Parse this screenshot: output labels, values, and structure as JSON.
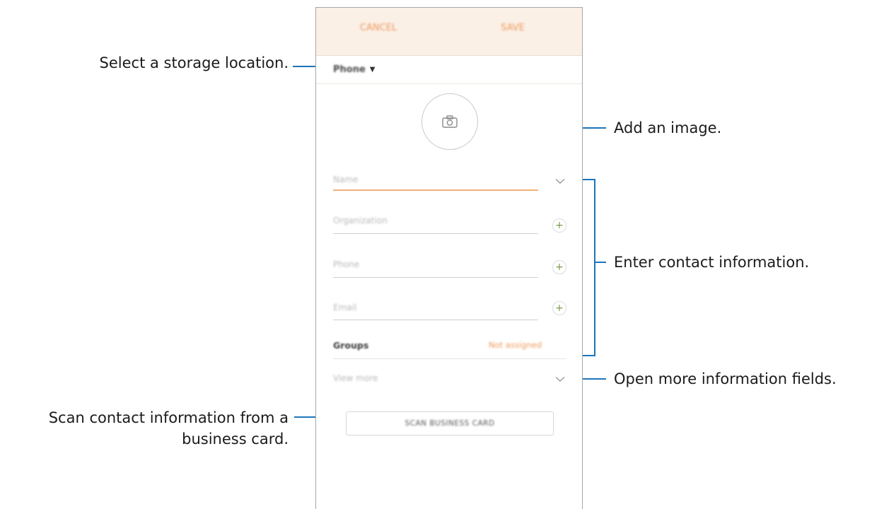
{
  "callouts": {
    "storage": "Select a storage location.",
    "image": "Add an image.",
    "contact_info": "Enter contact information.",
    "more_fields": "Open more information fields.",
    "scan_line1": "Scan contact information from a",
    "scan_line2": "business card."
  },
  "topbar": {
    "cancel_label": "CANCEL",
    "save_label": "SAVE"
  },
  "storage": {
    "selected": "Phone"
  },
  "fields": {
    "name_placeholder": "Name",
    "organization_placeholder": "Organization",
    "phone_placeholder": "Phone",
    "email_placeholder": "Email"
  },
  "groups": {
    "label": "Groups",
    "value": "Not assigned"
  },
  "view_more": "View more",
  "scan_button": "SCAN BUSINESS CARD",
  "colors": {
    "accent": "#ef9a5a",
    "topbar_bg": "#fbf0e6",
    "callout_line": "#1c75bc",
    "plus": "#7a9a4a"
  },
  "icons": [
    "camera-icon",
    "chevron-down-icon",
    "plus-icon",
    "dropdown-caret-icon"
  ]
}
